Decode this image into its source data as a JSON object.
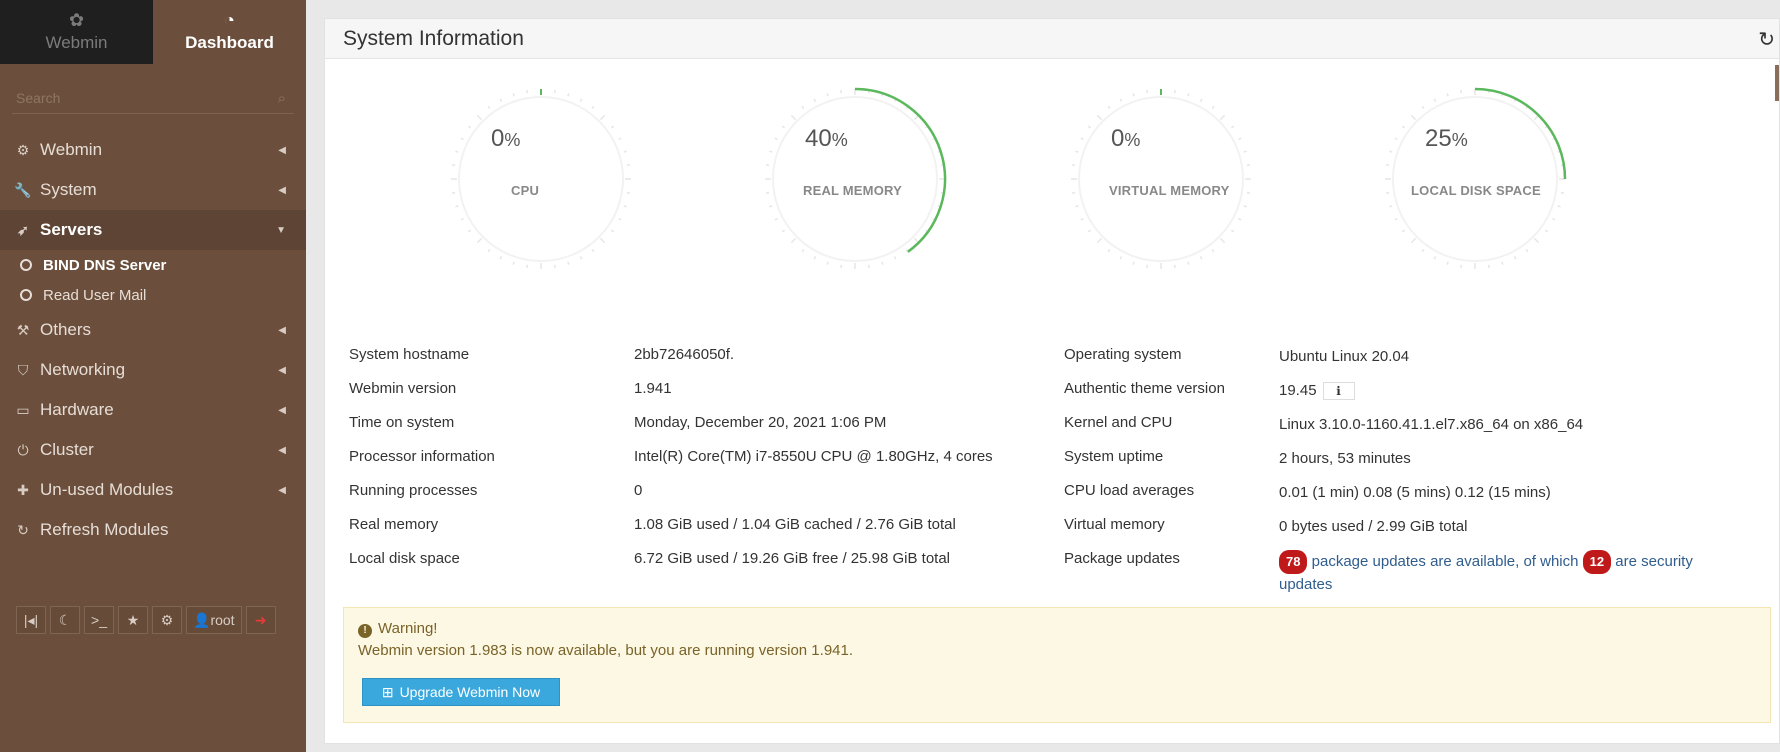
{
  "sidebar": {
    "tabs": [
      {
        "label": "Webmin",
        "icon": "webmin-logo-icon"
      },
      {
        "label": "Dashboard",
        "icon": "dashboard-icon"
      }
    ],
    "search_placeholder": "Search",
    "menu": {
      "webmin": "Webmin",
      "system": "System",
      "servers": "Servers",
      "servers_sub": [
        "BIND DNS Server",
        "Read User Mail"
      ],
      "others": "Others",
      "networking": "Networking",
      "hardware": "Hardware",
      "cluster": "Cluster",
      "unused": "Un-used Modules",
      "refresh": "Refresh Modules"
    },
    "bottom_user": "root"
  },
  "panel": {
    "title": "System Information",
    "gauges": [
      {
        "label": "CPU",
        "value": "0",
        "percent": 0
      },
      {
        "label": "REAL MEMORY",
        "value": "40",
        "percent": 40
      },
      {
        "label": "VIRTUAL MEMORY",
        "value": "0",
        "percent": 0
      },
      {
        "label": "LOCAL DISK SPACE",
        "value": "25",
        "percent": 25
      }
    ],
    "percent_sign": "%",
    "gauge_color": "#5cb85c",
    "info": {
      "hostname_key": "System hostname",
      "hostname_val": "2bb72646050f.",
      "webmin_ver_key": "Webmin version",
      "webmin_ver_val": "1.941",
      "time_key": "Time on system",
      "time_val": "Monday, December 20, 2021 1:06 PM",
      "proc_key": "Processor information",
      "proc_val": "Intel(R) Core(TM) i7-8550U CPU @ 1.80GHz, 4 cores",
      "running_key": "Running processes",
      "running_val": "0",
      "realmem_key": "Real memory",
      "realmem_val": "1.08 GiB used / 1.04 GiB cached / 2.76 GiB total",
      "disk_key": "Local disk space",
      "disk_val": "6.72 GiB used / 19.26 GiB free / 25.98 GiB total",
      "os_key": "Operating system",
      "os_val": "Ubuntu Linux 20.04",
      "theme_key": "Authentic theme version",
      "theme_val": "19.45",
      "kernel_key": "Kernel and CPU",
      "kernel_val": "Linux 3.10.0-1160.41.1.el7.x86_64 on x86_64",
      "uptime_key": "System uptime",
      "uptime_val": "2 hours, 53 minutes",
      "load_key": "CPU load averages",
      "load_val": "0.01 (1 min) 0.08 (5 mins) 0.12 (15 mins)",
      "vmem_key": "Virtual memory",
      "vmem_val": "0 bytes used / 2.99 GiB total",
      "pkg_key": "Package updates",
      "pkg_count": "78",
      "pkg_text1": "package updates are available, of which",
      "pkg_security": "12",
      "pkg_text2": "are security updates"
    },
    "warning": {
      "title": "Warning!",
      "text": "Webmin version 1.983 is now available, but you are running version 1.941.",
      "button": "Upgrade Webmin Now"
    }
  }
}
